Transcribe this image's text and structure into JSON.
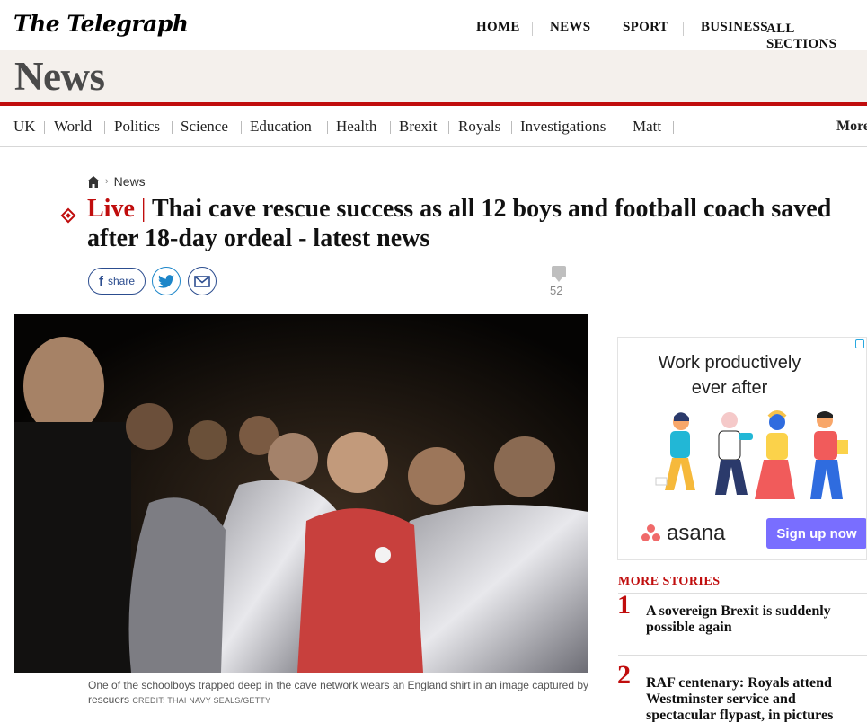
{
  "header": {
    "logo": "The Telegraph",
    "nav": [
      "HOME",
      "NEWS",
      "SPORT",
      "BUSINESS"
    ],
    "all_sections": "ALL SECTIONS"
  },
  "section": {
    "title": "News"
  },
  "subnav": {
    "items": [
      "UK",
      "World",
      "Politics",
      "Science",
      "Education",
      "Health",
      "Brexit",
      "Royals",
      "Investigations",
      "Matt"
    ],
    "more": "More"
  },
  "breadcrumb": {
    "current": "News"
  },
  "article": {
    "live_label": "Live",
    "separator": "|",
    "headline": "Thai cave rescue success as all 12 boys and football coach saved after 18-day ordeal - latest news",
    "share_label": "share",
    "comment_count": "52",
    "caption": "One of the schoolboys trapped deep in the cave network wears an England shirt in an image captured by rescuers",
    "credit": "CREDIT: THAI NAVY SEALS/GETTY"
  },
  "ad": {
    "headline_line1": "Work productively",
    "headline_line2": "ever after",
    "brand": "asana",
    "cta": "Sign up now"
  },
  "more_stories": {
    "title": "MORE STORIES",
    "items": [
      {
        "num": "1",
        "title": "A sovereign Brexit is suddenly possible again"
      },
      {
        "num": "2",
        "title": "RAF centenary: Royals attend Westminster service and spectacular flypast, in pictures"
      }
    ]
  },
  "colors": {
    "brand_red": "#c00d0d",
    "section_band": "#f4f0ec",
    "asana_purple": "#796eff",
    "asana_coral": "#f06a6a"
  }
}
